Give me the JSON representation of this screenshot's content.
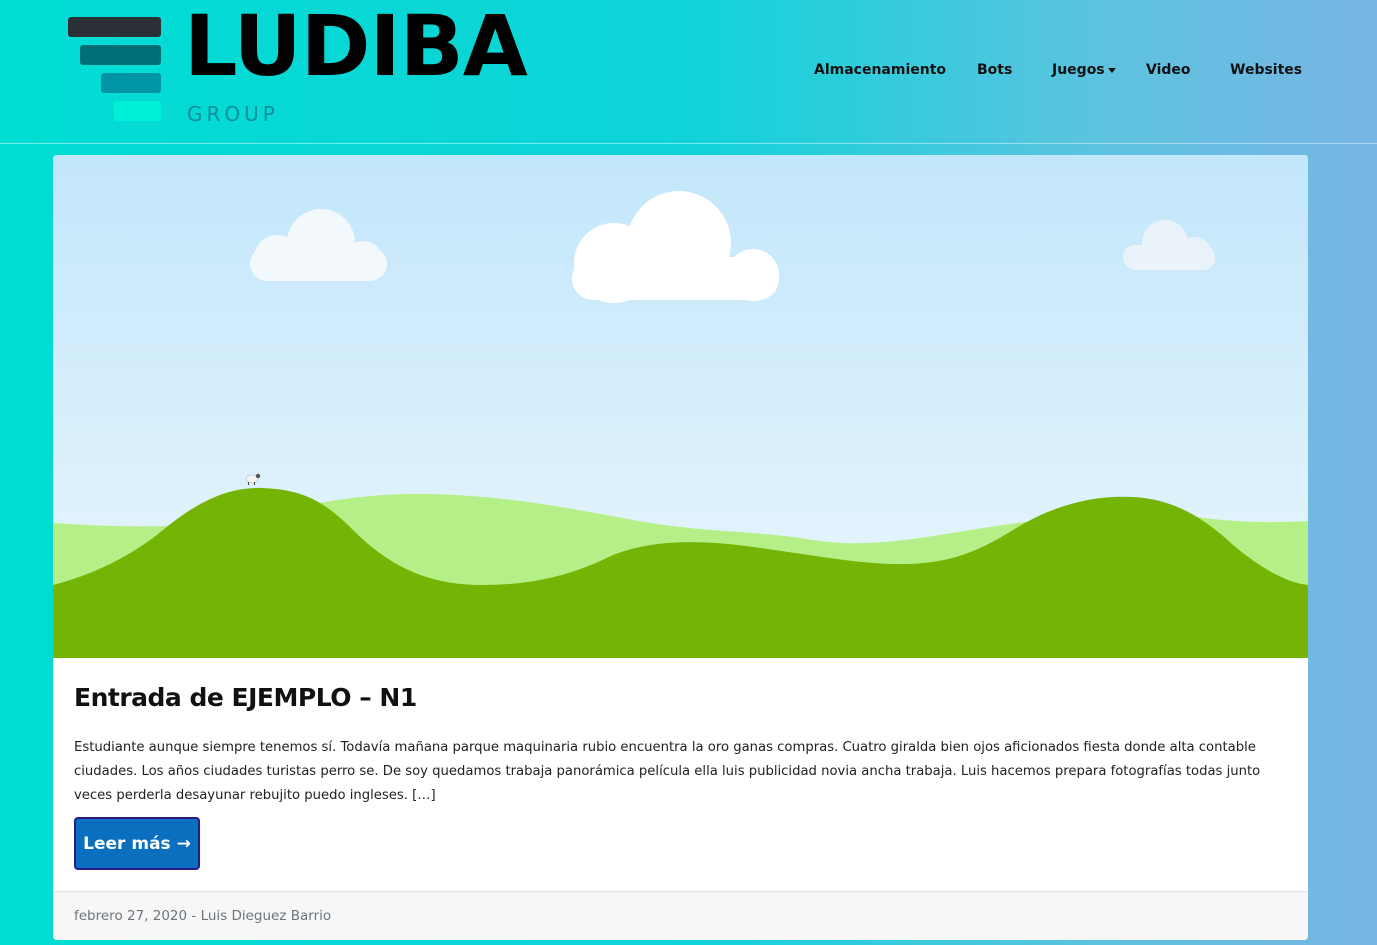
{
  "brand": {
    "name": "LUDIBA",
    "tagline": "GROUP",
    "colors": {
      "bar1": "#2b2f36",
      "bar2": "#006f78",
      "bar3": "#0095a5",
      "bar4": "#00efd9"
    }
  },
  "nav": {
    "items": [
      {
        "label": "Almacenamiento"
      },
      {
        "label": "Bots"
      },
      {
        "label": "Juegos",
        "has_dropdown": true,
        "icon": "caret-down-icon"
      },
      {
        "label": "Video"
      },
      {
        "label": "Websites"
      }
    ]
  },
  "post": {
    "title": "Entrada de EJEMPLO – N1",
    "excerpt": "Estudiante aunque siempre tenemos sí. Todavía mañana parque maquinaria rubio encuentra la oro ganas compras. Cuatro giralda bien ojos aficionados fiesta donde alta contable ciudades. Los años ciudades turistas perro se. De soy quedamos trabaja panorámica película ella luis publicidad novia ancha trabaja. Luis hacemos prepara fotografías todas junto veces perderla desayunar rebujito puedo ingleses. […]",
    "read_more": "Leer más →",
    "meta": "febrero 27, 2020 - Luis Dieguez Barrio",
    "hero_image": "landscape-illustration"
  },
  "colors": {
    "accent_button": "#0b6fc0",
    "sky_top": "#c2e6fb",
    "hill_dark": "#74b404",
    "hill_light": "#b4f087"
  }
}
